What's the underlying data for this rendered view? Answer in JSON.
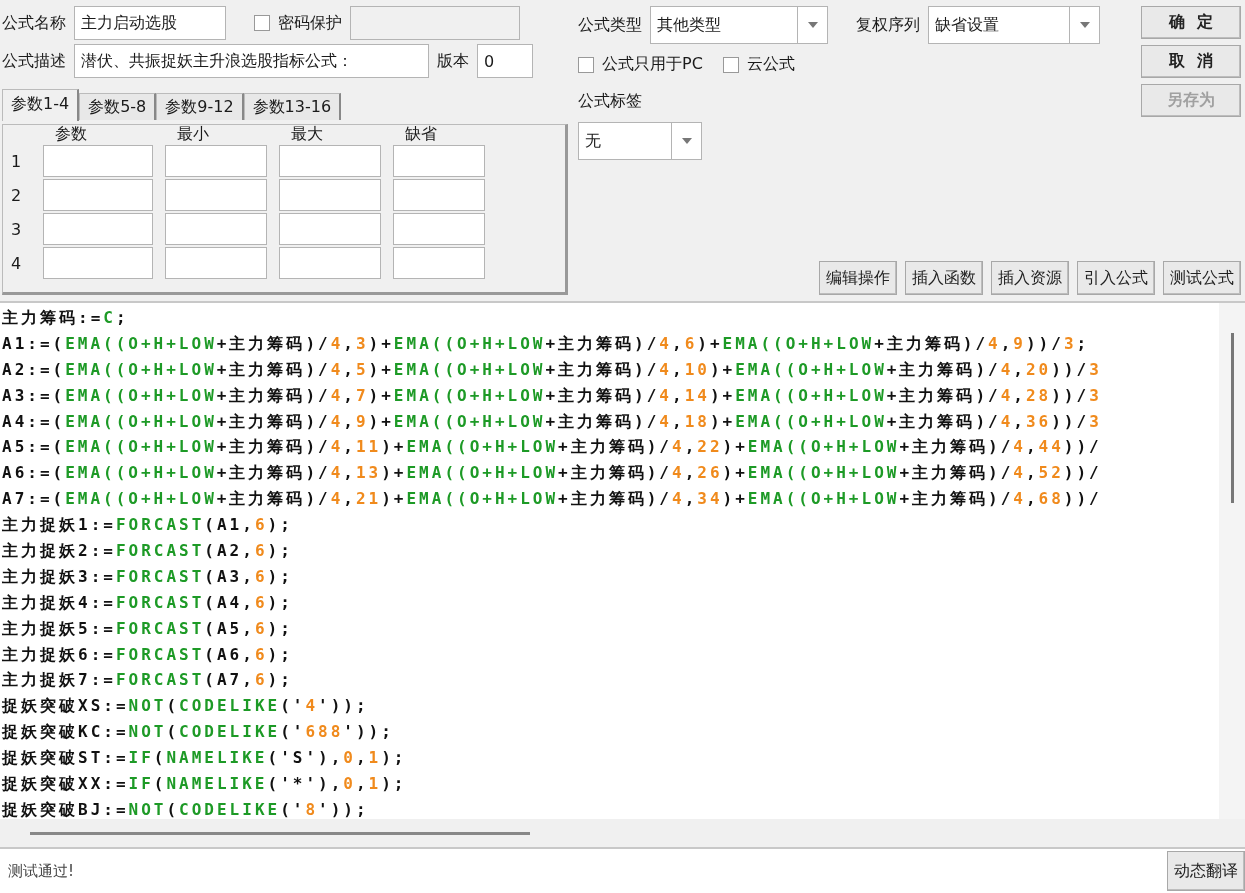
{
  "form": {
    "name_label": "公式名称",
    "name_value": "主力启动选股",
    "password": {
      "label": "密码保护",
      "checked": false
    },
    "desc_label": "公式描述",
    "desc_value": "潜伏、共振捉妖主升浪选股指标公式：",
    "version_label": "版本",
    "version_value": "0",
    "type_label": "公式类型",
    "type_value": "其他类型",
    "rights_label": "复权序列",
    "rights_value": "缺省设置",
    "options": [
      {
        "label": "公式只用于PC",
        "checked": false
      },
      {
        "label": "云公式",
        "checked": false
      }
    ],
    "tag_label": "公式标签",
    "tag_value": "无"
  },
  "actions": [
    {
      "label": "确  定",
      "disabled": false
    },
    {
      "label": "取  消",
      "disabled": false
    },
    {
      "label": "另存为",
      "disabled": true
    }
  ],
  "tabs": [
    {
      "label": "参数1-4",
      "selected": true
    },
    {
      "label": "参数5-8",
      "selected": false
    },
    {
      "label": "参数9-12",
      "selected": false
    },
    {
      "label": "参数13-16",
      "selected": false
    }
  ],
  "params": {
    "columns": [
      "参数",
      "最小",
      "最大",
      "缺省"
    ],
    "rows": [
      "1",
      "2",
      "3",
      "4"
    ]
  },
  "toolbar": [
    "编辑操作",
    "插入函数",
    "插入资源",
    "引入公式",
    "测试公式"
  ],
  "code": [
    [
      {
        "kind": "plain",
        "text": "主力筹码:="
      },
      {
        "kind": "fn",
        "text": "C"
      },
      {
        "kind": "plain",
        "text": ";"
      }
    ],
    [
      {
        "kind": "plain",
        "text": "A1:=("
      },
      {
        "kind": "fn",
        "text": "EMA((O+H+LOW"
      },
      {
        "kind": "plain",
        "text": "+主力筹码)/"
      },
      {
        "kind": "num",
        "text": "4"
      },
      {
        "kind": "plain",
        "text": ","
      },
      {
        "kind": "num",
        "text": "3"
      },
      {
        "kind": "plain",
        "text": ")+"
      },
      {
        "kind": "fn",
        "text": "EMA((O+H+LOW"
      },
      {
        "kind": "plain",
        "text": "+主力筹码)/"
      },
      {
        "kind": "num",
        "text": "4"
      },
      {
        "kind": "plain",
        "text": ","
      },
      {
        "kind": "num",
        "text": "6"
      },
      {
        "kind": "plain",
        "text": ")+"
      },
      {
        "kind": "fn",
        "text": "EMA((O+H+LOW"
      },
      {
        "kind": "plain",
        "text": "+主力筹码)/"
      },
      {
        "kind": "num",
        "text": "4"
      },
      {
        "kind": "plain",
        "text": ","
      },
      {
        "kind": "num",
        "text": "9"
      },
      {
        "kind": "plain",
        "text": "))/"
      },
      {
        "kind": "num",
        "text": "3"
      },
      {
        "kind": "plain",
        "text": ";"
      }
    ],
    [
      {
        "kind": "plain",
        "text": "A2:=("
      },
      {
        "kind": "fn",
        "text": "EMA((O+H+LOW"
      },
      {
        "kind": "plain",
        "text": "+主力筹码)/"
      },
      {
        "kind": "num",
        "text": "4"
      },
      {
        "kind": "plain",
        "text": ","
      },
      {
        "kind": "num",
        "text": "5"
      },
      {
        "kind": "plain",
        "text": ")+"
      },
      {
        "kind": "fn",
        "text": "EMA((O+H+LOW"
      },
      {
        "kind": "plain",
        "text": "+主力筹码)/"
      },
      {
        "kind": "num",
        "text": "4"
      },
      {
        "kind": "plain",
        "text": ","
      },
      {
        "kind": "num",
        "text": "10"
      },
      {
        "kind": "plain",
        "text": ")+"
      },
      {
        "kind": "fn",
        "text": "EMA((O+H+LOW"
      },
      {
        "kind": "plain",
        "text": "+主力筹码)/"
      },
      {
        "kind": "num",
        "text": "4"
      },
      {
        "kind": "plain",
        "text": ","
      },
      {
        "kind": "num",
        "text": "20"
      },
      {
        "kind": "plain",
        "text": "))/"
      },
      {
        "kind": "num",
        "text": "3"
      }
    ],
    [
      {
        "kind": "plain",
        "text": "A3:=("
      },
      {
        "kind": "fn",
        "text": "EMA((O+H+LOW"
      },
      {
        "kind": "plain",
        "text": "+主力筹码)/"
      },
      {
        "kind": "num",
        "text": "4"
      },
      {
        "kind": "plain",
        "text": ","
      },
      {
        "kind": "num",
        "text": "7"
      },
      {
        "kind": "plain",
        "text": ")+"
      },
      {
        "kind": "fn",
        "text": "EMA((O+H+LOW"
      },
      {
        "kind": "plain",
        "text": "+主力筹码)/"
      },
      {
        "kind": "num",
        "text": "4"
      },
      {
        "kind": "plain",
        "text": ","
      },
      {
        "kind": "num",
        "text": "14"
      },
      {
        "kind": "plain",
        "text": ")+"
      },
      {
        "kind": "fn",
        "text": "EMA((O+H+LOW"
      },
      {
        "kind": "plain",
        "text": "+主力筹码)/"
      },
      {
        "kind": "num",
        "text": "4"
      },
      {
        "kind": "plain",
        "text": ","
      },
      {
        "kind": "num",
        "text": "28"
      },
      {
        "kind": "plain",
        "text": "))/"
      },
      {
        "kind": "num",
        "text": "3"
      }
    ],
    [
      {
        "kind": "plain",
        "text": "A4:=("
      },
      {
        "kind": "fn",
        "text": "EMA((O+H+LOW"
      },
      {
        "kind": "plain",
        "text": "+主力筹码)/"
      },
      {
        "kind": "num",
        "text": "4"
      },
      {
        "kind": "plain",
        "text": ","
      },
      {
        "kind": "num",
        "text": "9"
      },
      {
        "kind": "plain",
        "text": ")+"
      },
      {
        "kind": "fn",
        "text": "EMA((O+H+LOW"
      },
      {
        "kind": "plain",
        "text": "+主力筹码)/"
      },
      {
        "kind": "num",
        "text": "4"
      },
      {
        "kind": "plain",
        "text": ","
      },
      {
        "kind": "num",
        "text": "18"
      },
      {
        "kind": "plain",
        "text": ")+"
      },
      {
        "kind": "fn",
        "text": "EMA((O+H+LOW"
      },
      {
        "kind": "plain",
        "text": "+主力筹码)/"
      },
      {
        "kind": "num",
        "text": "4"
      },
      {
        "kind": "plain",
        "text": ","
      },
      {
        "kind": "num",
        "text": "36"
      },
      {
        "kind": "plain",
        "text": "))/"
      },
      {
        "kind": "num",
        "text": "3"
      }
    ],
    [
      {
        "kind": "plain",
        "text": "A5:=("
      },
      {
        "kind": "fn",
        "text": "EMA((O+H+LOW"
      },
      {
        "kind": "plain",
        "text": "+主力筹码)/"
      },
      {
        "kind": "num",
        "text": "4"
      },
      {
        "kind": "plain",
        "text": ","
      },
      {
        "kind": "num",
        "text": "11"
      },
      {
        "kind": "plain",
        "text": ")+"
      },
      {
        "kind": "fn",
        "text": "EMA((O+H+LOW"
      },
      {
        "kind": "plain",
        "text": "+主力筹码)/"
      },
      {
        "kind": "num",
        "text": "4"
      },
      {
        "kind": "plain",
        "text": ","
      },
      {
        "kind": "num",
        "text": "22"
      },
      {
        "kind": "plain",
        "text": ")+"
      },
      {
        "kind": "fn",
        "text": "EMA((O+H+LOW"
      },
      {
        "kind": "plain",
        "text": "+主力筹码)/"
      },
      {
        "kind": "num",
        "text": "4"
      },
      {
        "kind": "plain",
        "text": ","
      },
      {
        "kind": "num",
        "text": "44"
      },
      {
        "kind": "plain",
        "text": "))/"
      }
    ],
    [
      {
        "kind": "plain",
        "text": "A6:=("
      },
      {
        "kind": "fn",
        "text": "EMA((O+H+LOW"
      },
      {
        "kind": "plain",
        "text": "+主力筹码)/"
      },
      {
        "kind": "num",
        "text": "4"
      },
      {
        "kind": "plain",
        "text": ","
      },
      {
        "kind": "num",
        "text": "13"
      },
      {
        "kind": "plain",
        "text": ")+"
      },
      {
        "kind": "fn",
        "text": "EMA((O+H+LOW"
      },
      {
        "kind": "plain",
        "text": "+主力筹码)/"
      },
      {
        "kind": "num",
        "text": "4"
      },
      {
        "kind": "plain",
        "text": ","
      },
      {
        "kind": "num",
        "text": "26"
      },
      {
        "kind": "plain",
        "text": ")+"
      },
      {
        "kind": "fn",
        "text": "EMA((O+H+LOW"
      },
      {
        "kind": "plain",
        "text": "+主力筹码)/"
      },
      {
        "kind": "num",
        "text": "4"
      },
      {
        "kind": "plain",
        "text": ","
      },
      {
        "kind": "num",
        "text": "52"
      },
      {
        "kind": "plain",
        "text": "))/"
      }
    ],
    [
      {
        "kind": "plain",
        "text": "A7:=("
      },
      {
        "kind": "fn",
        "text": "EMA((O+H+LOW"
      },
      {
        "kind": "plain",
        "text": "+主力筹码)/"
      },
      {
        "kind": "num",
        "text": "4"
      },
      {
        "kind": "plain",
        "text": ","
      },
      {
        "kind": "num",
        "text": "21"
      },
      {
        "kind": "plain",
        "text": ")+"
      },
      {
        "kind": "fn",
        "text": "EMA((O+H+LOW"
      },
      {
        "kind": "plain",
        "text": "+主力筹码)/"
      },
      {
        "kind": "num",
        "text": "4"
      },
      {
        "kind": "plain",
        "text": ","
      },
      {
        "kind": "num",
        "text": "34"
      },
      {
        "kind": "plain",
        "text": ")+"
      },
      {
        "kind": "fn",
        "text": "EMA((O+H+LOW"
      },
      {
        "kind": "plain",
        "text": "+主力筹码)/"
      },
      {
        "kind": "num",
        "text": "4"
      },
      {
        "kind": "plain",
        "text": ","
      },
      {
        "kind": "num",
        "text": "68"
      },
      {
        "kind": "plain",
        "text": "))/"
      }
    ],
    [
      {
        "kind": "plain",
        "text": "主力捉妖1:="
      },
      {
        "kind": "fn",
        "text": "FORCAST"
      },
      {
        "kind": "plain",
        "text": "(A1,"
      },
      {
        "kind": "num",
        "text": "6"
      },
      {
        "kind": "plain",
        "text": ");"
      }
    ],
    [
      {
        "kind": "plain",
        "text": "主力捉妖2:="
      },
      {
        "kind": "fn",
        "text": "FORCAST"
      },
      {
        "kind": "plain",
        "text": "(A2,"
      },
      {
        "kind": "num",
        "text": "6"
      },
      {
        "kind": "plain",
        "text": ");"
      }
    ],
    [
      {
        "kind": "plain",
        "text": "主力捉妖3:="
      },
      {
        "kind": "fn",
        "text": "FORCAST"
      },
      {
        "kind": "plain",
        "text": "(A3,"
      },
      {
        "kind": "num",
        "text": "6"
      },
      {
        "kind": "plain",
        "text": ");"
      }
    ],
    [
      {
        "kind": "plain",
        "text": "主力捉妖4:="
      },
      {
        "kind": "fn",
        "text": "FORCAST"
      },
      {
        "kind": "plain",
        "text": "(A4,"
      },
      {
        "kind": "num",
        "text": "6"
      },
      {
        "kind": "plain",
        "text": ");"
      }
    ],
    [
      {
        "kind": "plain",
        "text": "主力捉妖5:="
      },
      {
        "kind": "fn",
        "text": "FORCAST"
      },
      {
        "kind": "plain",
        "text": "(A5,"
      },
      {
        "kind": "num",
        "text": "6"
      },
      {
        "kind": "plain",
        "text": ");"
      }
    ],
    [
      {
        "kind": "plain",
        "text": "主力捉妖6:="
      },
      {
        "kind": "fn",
        "text": "FORCAST"
      },
      {
        "kind": "plain",
        "text": "(A6,"
      },
      {
        "kind": "num",
        "text": "6"
      },
      {
        "kind": "plain",
        "text": ");"
      }
    ],
    [
      {
        "kind": "plain",
        "text": "主力捉妖7:="
      },
      {
        "kind": "fn",
        "text": "FORCAST"
      },
      {
        "kind": "plain",
        "text": "(A7,"
      },
      {
        "kind": "num",
        "text": "6"
      },
      {
        "kind": "plain",
        "text": ");"
      }
    ],
    [
      {
        "kind": "plain",
        "text": "捉妖突破XS:="
      },
      {
        "kind": "fn",
        "text": "NOT"
      },
      {
        "kind": "plain",
        "text": "("
      },
      {
        "kind": "fn",
        "text": "CODELIKE"
      },
      {
        "kind": "plain",
        "text": "('"
      },
      {
        "kind": "num",
        "text": "4"
      },
      {
        "kind": "plain",
        "text": "'));"
      }
    ],
    [
      {
        "kind": "plain",
        "text": "捉妖突破KC:="
      },
      {
        "kind": "fn",
        "text": "NOT"
      },
      {
        "kind": "plain",
        "text": "("
      },
      {
        "kind": "fn",
        "text": "CODELIKE"
      },
      {
        "kind": "plain",
        "text": "('"
      },
      {
        "kind": "num",
        "text": "688"
      },
      {
        "kind": "plain",
        "text": "'));"
      }
    ],
    [
      {
        "kind": "plain",
        "text": "捉妖突破ST:="
      },
      {
        "kind": "fn",
        "text": "IF"
      },
      {
        "kind": "plain",
        "text": "("
      },
      {
        "kind": "fn",
        "text": "NAMELIKE"
      },
      {
        "kind": "plain",
        "text": "('S'),"
      },
      {
        "kind": "num",
        "text": "0"
      },
      {
        "kind": "plain",
        "text": ","
      },
      {
        "kind": "num",
        "text": "1"
      },
      {
        "kind": "plain",
        "text": ");"
      }
    ],
    [
      {
        "kind": "plain",
        "text": "捉妖突破XX:="
      },
      {
        "kind": "fn",
        "text": "IF"
      },
      {
        "kind": "plain",
        "text": "("
      },
      {
        "kind": "fn",
        "text": "NAMELIKE"
      },
      {
        "kind": "plain",
        "text": "('*'),"
      },
      {
        "kind": "num",
        "text": "0"
      },
      {
        "kind": "plain",
        "text": ","
      },
      {
        "kind": "num",
        "text": "1"
      },
      {
        "kind": "plain",
        "text": ");"
      }
    ],
    [
      {
        "kind": "plain",
        "text": "捉妖突破BJ:="
      },
      {
        "kind": "fn",
        "text": "NOT"
      },
      {
        "kind": "plain",
        "text": "("
      },
      {
        "kind": "fn",
        "text": "CODELIKE"
      },
      {
        "kind": "plain",
        "text": "('"
      },
      {
        "kind": "num",
        "text": "8"
      },
      {
        "kind": "plain",
        "text": "'));"
      }
    ]
  ],
  "status": {
    "message": "测试通过!",
    "button": "动态翻译"
  }
}
